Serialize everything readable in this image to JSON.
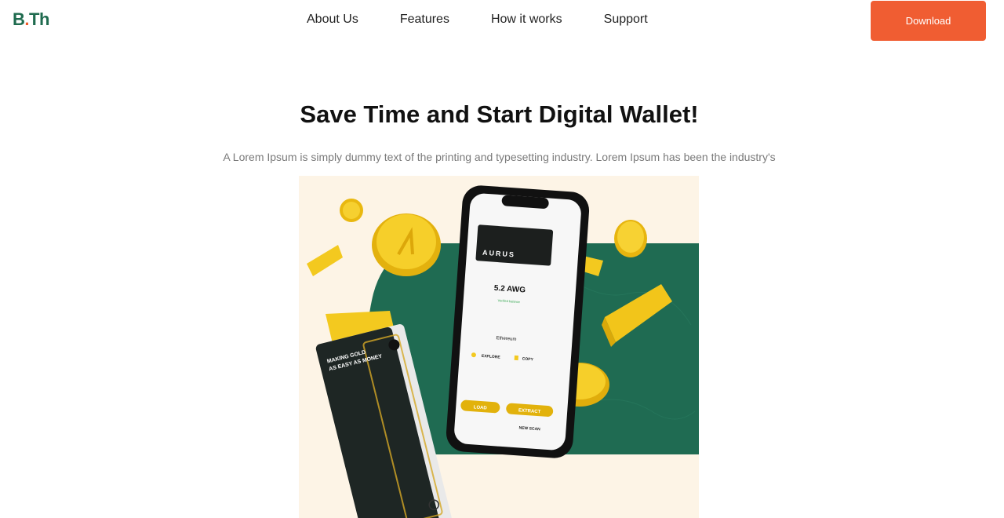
{
  "header": {
    "logo": {
      "prefix": "B",
      "dot": ".",
      "suffix": "Th"
    },
    "nav": [
      "About Us",
      "Features",
      "How it works",
      "Support"
    ],
    "download_label": "Download"
  },
  "hero": {
    "title": "Save Time and Start Digital Wallet!",
    "subtitle": "A Lorem Ipsum is simply dummy text of the printing and typesetting industry. Lorem Ipsum has been the industry's"
  },
  "illustration": {
    "card_brand": "AURUS",
    "balance": "5.2 AWG",
    "status": "Verified balance",
    "network": "Ethereum",
    "explore_label": "EXPLORE",
    "copy_label": "COPY",
    "load_label": "LOAD",
    "extract_label": "EXTRACT",
    "new_scan_label": "NEW SCAN",
    "slogan_line1": "MAKING GOLD",
    "slogan_line2": "AS EASY AS MONEY",
    "colors": {
      "green": "#1f6b52",
      "gold": "#f2c81c",
      "card": "#1e2624",
      "background": "#fdf4e6"
    }
  }
}
